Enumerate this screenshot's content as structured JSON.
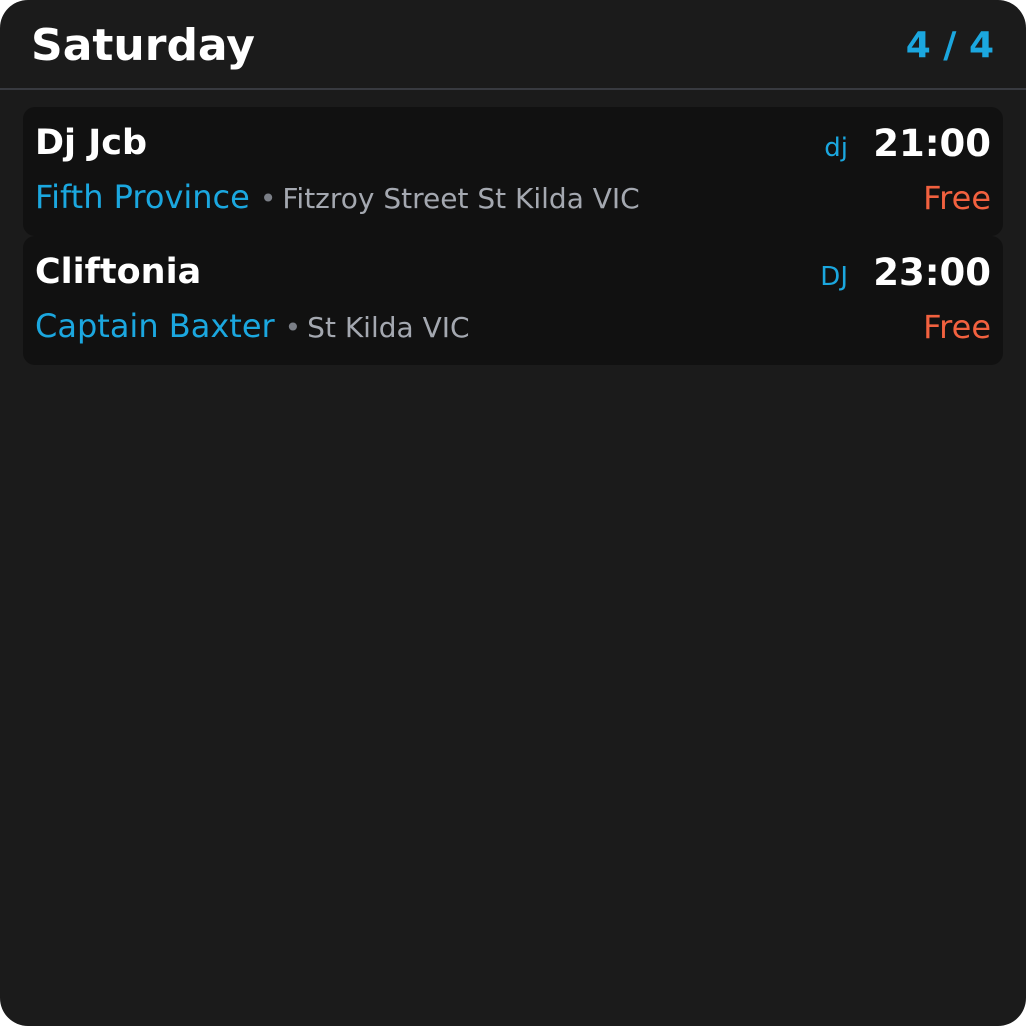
{
  "header": {
    "title": "Saturday",
    "page_counter": "4 / 4"
  },
  "events": [
    {
      "name": "Dj Jcb",
      "genre": "dj",
      "time": "21:00",
      "venue": "Fifth Province",
      "separator": "•",
      "address": "Fitzroy Street St Kilda VIC",
      "price": "Free"
    },
    {
      "name": "Cliftonia",
      "genre": "DJ",
      "time": "23:00",
      "venue": "Captain Baxter",
      "separator": "•",
      "address": "St Kilda VIC",
      "price": "Free"
    }
  ],
  "colors": {
    "background": "#1b1b1b",
    "card": "#111111",
    "accent": "#1ba7df",
    "price": "#f2613f",
    "muted": "#a4a8b0"
  }
}
